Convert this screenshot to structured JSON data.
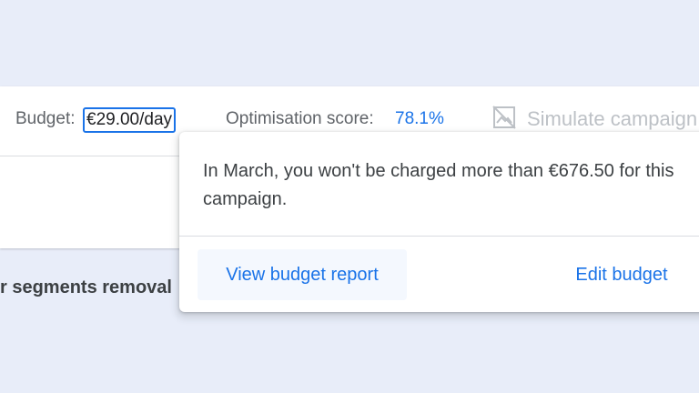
{
  "toolbar": {
    "budget_label": "Budget:",
    "budget_value": "€29.00/day",
    "optimisation_label": "Optimisation score:",
    "optimisation_value": "78.1%",
    "simulate_label": "Simulate campaign",
    "simulate_icon": "image-off-icon"
  },
  "background": {
    "segments_text": "r segments removal"
  },
  "budget_popover": {
    "message": "In March, you won't be charged more than €676.50 for this campaign.",
    "view_report_label": "View budget report",
    "edit_budget_label": "Edit budget"
  },
  "colors": {
    "accent": "#1a73e8",
    "page_background": "#e8edf9",
    "muted_text": "#5f6368",
    "disabled_text": "#bdc1c6"
  }
}
